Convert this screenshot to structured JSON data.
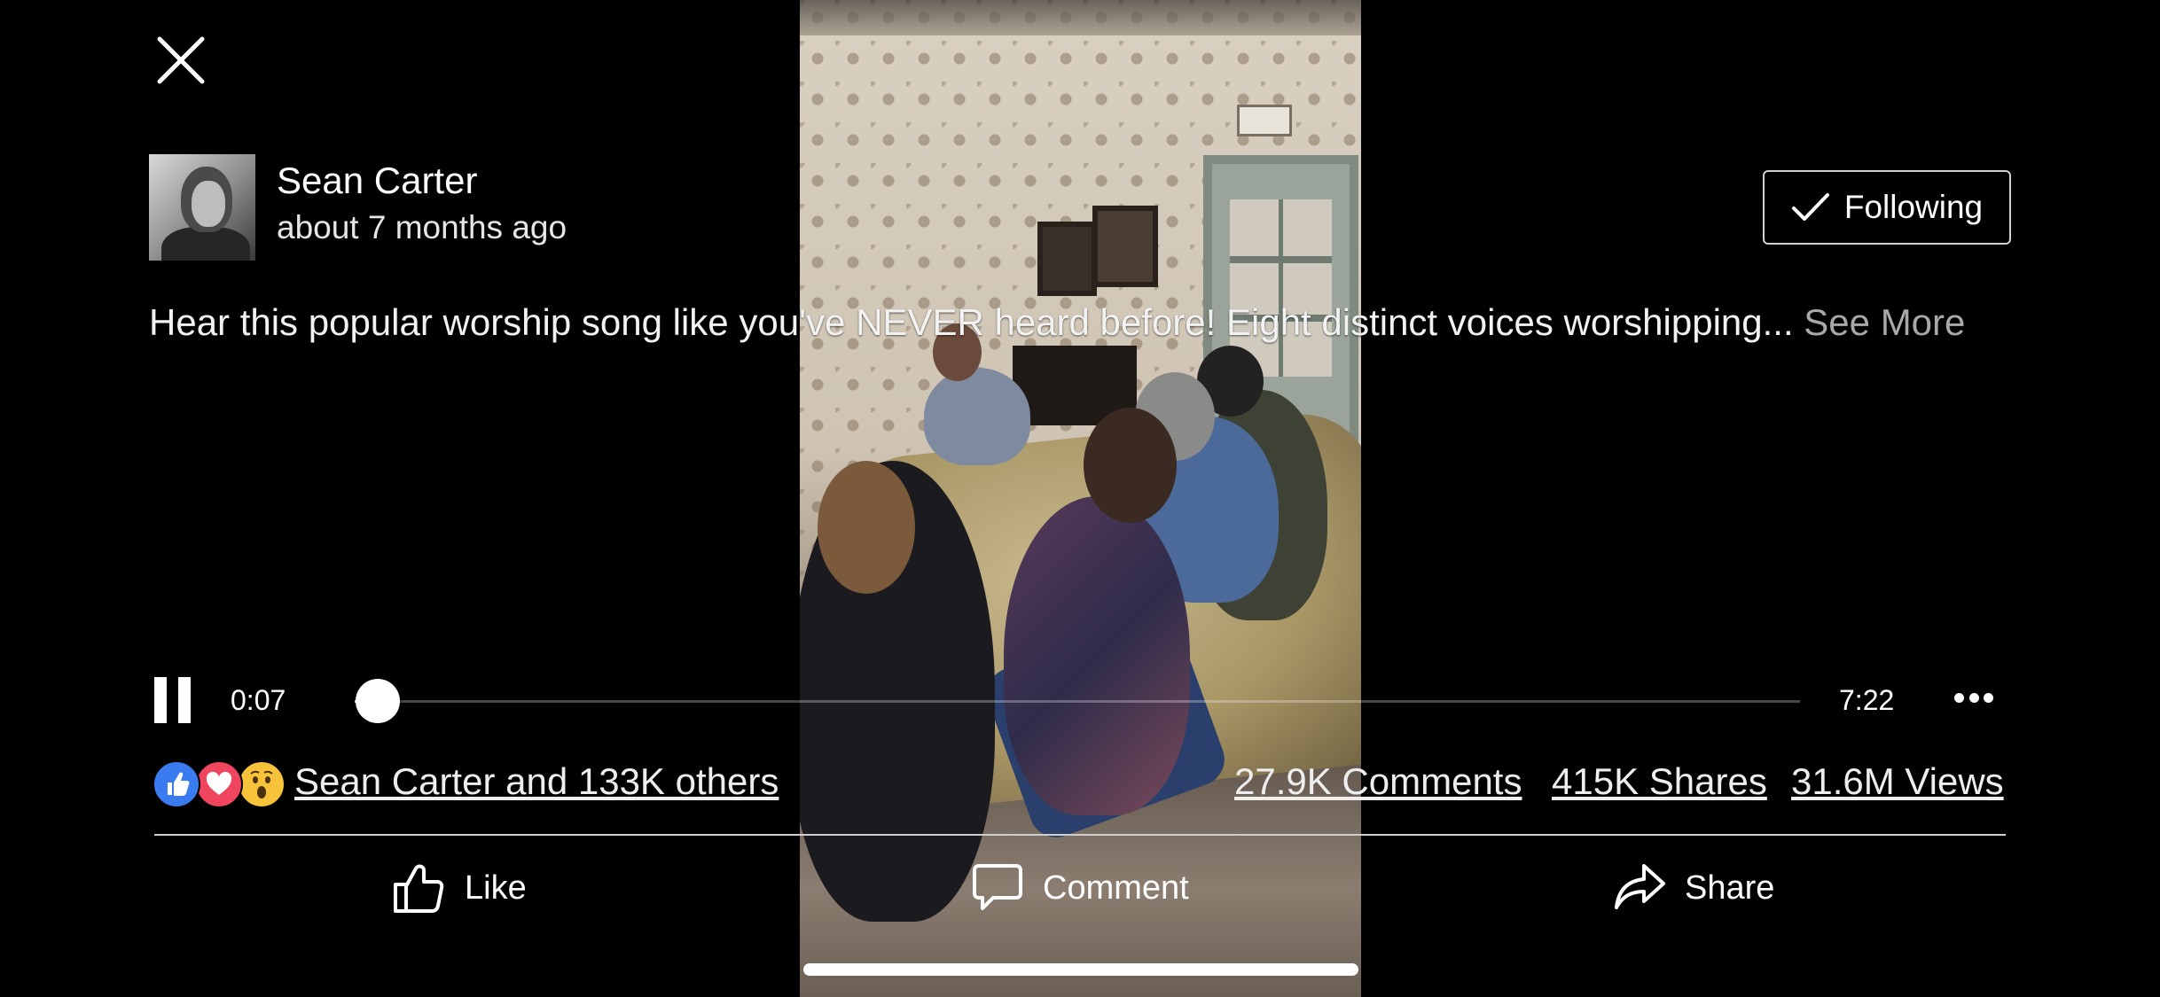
{
  "post": {
    "author_name": "Sean Carter",
    "timestamp": "about 7 months ago",
    "follow_label": "Following",
    "caption": "Hear this popular worship song like you've NEVER heard before! Eight distinct voices worshipping...",
    "see_more_label": "See More"
  },
  "player": {
    "current_time": "0:07",
    "total_time": "7:22",
    "progress_fraction": 0.016,
    "state": "playing"
  },
  "engagement": {
    "reactions": [
      "like",
      "love",
      "wow"
    ],
    "reactors_text": "Sean Carter and 133K others",
    "comments_text": "27.9K Comments",
    "shares_text": "415K Shares",
    "views_text": "31.6M Views"
  },
  "actions": {
    "like_label": "Like",
    "comment_label": "Comment",
    "share_label": "Share"
  },
  "icons": {
    "close": "close-icon",
    "follow": "checkmark-icon",
    "pause": "pause-icon",
    "more": "more-options-icon",
    "like": "thumbs-up-icon",
    "comment": "speech-bubble-icon",
    "share": "share-arrow-icon"
  },
  "colors": {
    "background": "#000000",
    "like_reaction": "#3b7bf0",
    "love_reaction": "#f0455e",
    "wow_reaction": "#f6c33b",
    "see_more": "#a8a8a8"
  }
}
